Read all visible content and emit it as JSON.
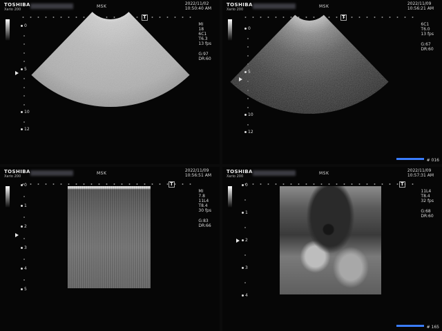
{
  "panels": [
    {
      "brand": "TOSHIBA",
      "model": "Xario 200",
      "mode": "MSK",
      "date": "2022/11/02",
      "time": "10:50:40 AM",
      "probe": "MI",
      "params": [
        "18",
        "6C1",
        "T6.3",
        "13 fps",
        "G:97",
        "DR:60"
      ],
      "scale": [
        {
          "v": "0",
          "d": 0
        },
        {
          "v": "5",
          "d": 5
        },
        {
          "v": "10",
          "d": 10
        },
        {
          "v": "12",
          "d": 12
        }
      ],
      "scale_max": 12,
      "focus": 5.4,
      "probe_type": "convex",
      "progress": null,
      "frame": null
    },
    {
      "brand": "TOSHIBA",
      "model": "Xario 200",
      "mode": "MSK",
      "date": "2022/11/09",
      "time": "10:56:21 AM",
      "probe": "",
      "params": [
        "6C1",
        "T6.0",
        "13 fps",
        "G:67",
        "DR:60"
      ],
      "scale": [
        {
          "v": "0",
          "d": 0
        },
        {
          "v": "5",
          "d": 5
        },
        {
          "v": "10",
          "d": 10
        },
        {
          "v": "12",
          "d": 12
        }
      ],
      "scale_max": 12,
      "focus": 5.8,
      "probe_type": "convex",
      "progress": 1.0,
      "frame": "# 016"
    },
    {
      "brand": "TOSHIBA",
      "model": "Xario 200",
      "mode": "MSK",
      "date": "2022/11/09",
      "time": "10:56:51 AM",
      "probe": "MI",
      "params": [
        "7.8",
        "11L4",
        "T8.4",
        "30 fps",
        "G:83",
        "DR:66"
      ],
      "scale": [
        {
          "v": "0",
          "d": 0
        },
        {
          "v": "1",
          "d": 1
        },
        {
          "v": "2",
          "d": 2
        },
        {
          "v": "3",
          "d": 3
        },
        {
          "v": "4",
          "d": 4
        },
        {
          "v": "5",
          "d": 5
        }
      ],
      "scale_max": 5,
      "focus": 2.4,
      "probe_type": "linear",
      "progress": null,
      "frame": null
    },
    {
      "brand": "TOSHIBA",
      "model": "Xario 200",
      "mode": "MSK",
      "date": "2022/11/09",
      "time": "10:57:31 AM",
      "probe": "",
      "params": [
        "11L4",
        "T8.4",
        "32 fps",
        "G:68",
        "DR:60"
      ],
      "scale": [
        {
          "v": "0",
          "d": 0
        },
        {
          "v": "1",
          "d": 1
        },
        {
          "v": "2",
          "d": 2
        },
        {
          "v": "3",
          "d": 3
        },
        {
          "v": "4",
          "d": 4
        }
      ],
      "scale_max": 4,
      "focus": 2.0,
      "probe_type": "linear",
      "progress": 1.0,
      "frame": "# 165"
    }
  ],
  "colors": {
    "progress": "#3a7dff",
    "progress_bg": "#0f2a55",
    "text": "#dddddd"
  }
}
